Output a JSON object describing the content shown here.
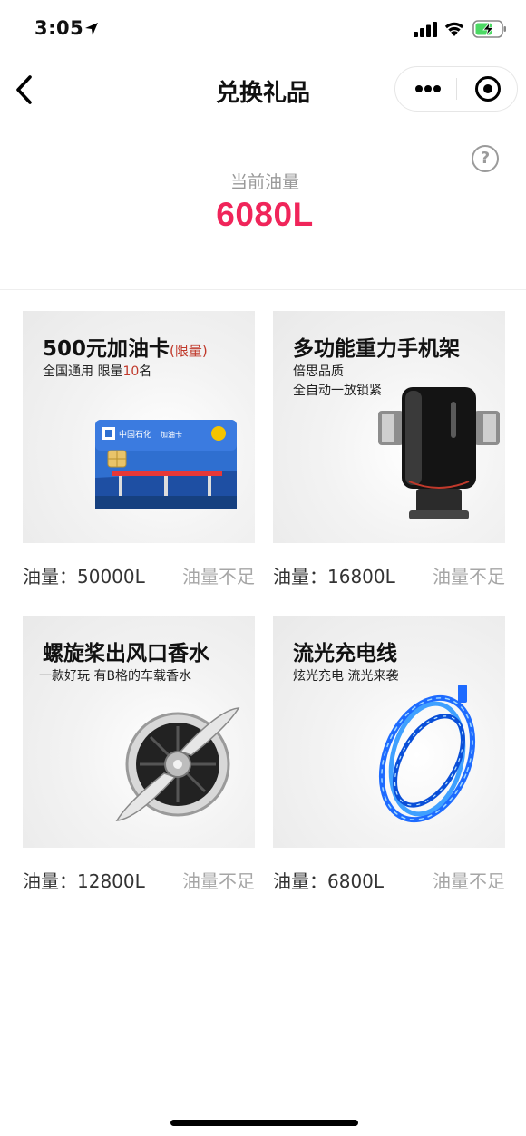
{
  "status_bar": {
    "time": "3:05",
    "icons": [
      "location-arrow-icon",
      "cellular-signal-icon",
      "wifi-icon",
      "battery-charging-icon"
    ]
  },
  "nav": {
    "title": "兑换礼品",
    "back_icon": "chevron-left-icon",
    "more_icon": "more-dots-icon",
    "close_icon": "target-close-icon"
  },
  "balance": {
    "label": "当前油量",
    "value": "6080L",
    "help_icon": "question-circle-icon",
    "help_glyph": "?",
    "accent_color": "#f0255a"
  },
  "gifts": [
    {
      "title": "500元加油卡",
      "title_suffix": "(限量)",
      "subtitle_line1_prefix": "全国通用 限量",
      "subtitle_line1_highlight": "10",
      "subtitle_line1_suffix": "名",
      "subtitle_line2": "",
      "card_brand": "中国石化",
      "card_label": "加油卡",
      "price_label": "油量：",
      "price_value": "50000L",
      "status": "油量不足"
    },
    {
      "title": "多功能重力手机架",
      "subtitle_line1": "倍思品质",
      "subtitle_line2": "全自动一放锁紧",
      "price_label": "油量：",
      "price_value": "16800L",
      "status": "油量不足"
    },
    {
      "title": "螺旋桨出风口香水",
      "subtitle_line1": "一款好玩 有B格的车载香水",
      "subtitle_line2": "",
      "price_label": "油量：",
      "price_value": "12800L",
      "status": "油量不足"
    },
    {
      "title": "流光充电线",
      "subtitle_line1": "炫光充电 流光来袭",
      "subtitle_line2": "",
      "price_label": "油量：",
      "price_value": "6800L",
      "status": "油量不足"
    }
  ],
  "colors": {
    "status_inactive": "#a6a6a6",
    "limited_red": "#c0392b"
  }
}
